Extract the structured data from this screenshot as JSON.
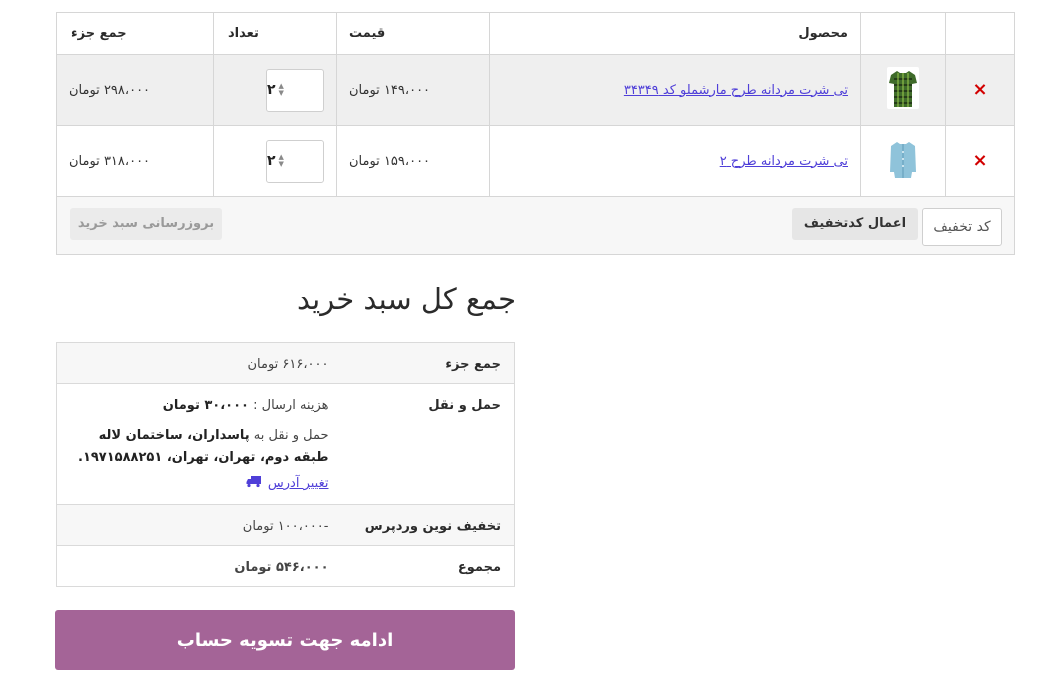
{
  "cart": {
    "headers": {
      "product": "محصول",
      "price": "قیمت",
      "quantity": "تعداد",
      "subtotal": "جمع جزء"
    },
    "items": [
      {
        "remove": "×",
        "name": "تی شرت مردانه طرح مارشملو کد ۳۴۳۴۹",
        "price": "۱۴۹،۰۰۰ تومان",
        "quantity": "۲",
        "subtotal": "۲۹۸،۰۰۰ تومان",
        "thumb_color": "#3f6b2a"
      },
      {
        "remove": "×",
        "name": "تی شرت مردانه طرح ۲",
        "price": "۱۵۹،۰۰۰ تومان",
        "quantity": "۲",
        "subtotal": "۳۱۸،۰۰۰ تومان",
        "thumb_color": "#8fc3da"
      }
    ],
    "coupon_placeholder": "کد تخفیف",
    "apply_coupon": "اعمال کدتخفیف",
    "update_cart": "بروزرسانی سبد خرید"
  },
  "totals": {
    "title": "جمع کل سبد خرید",
    "subtotal_label": "جمع جزء",
    "subtotal_value": "۶۱۶،۰۰۰ تومان",
    "shipping_label": "حمل و نقل",
    "shipping_method": "هزینه ارسال :",
    "shipping_cost": "۳۰،۰۰۰ تومان",
    "shipping_to_prefix": "حمل و نقل به",
    "shipping_address": "پاسداران، ساختمان لاله طبقه دوم، تهران، تهران، ۱۹۷۱۵۸۸۲۵۱.",
    "change_address": "تغییر آدرس",
    "discount_label": "تخفیف نوین وردپرس",
    "discount_value": "-۱۰۰،۰۰۰ تومان",
    "total_label": "مجموع",
    "total_value": "۵۴۶،۰۰۰ تومان"
  },
  "checkout_button": "ادامه جهت تسویه حساب",
  "colors": {
    "accent": "#a46497",
    "link": "#4f3fd8",
    "remove": "#d20000"
  }
}
